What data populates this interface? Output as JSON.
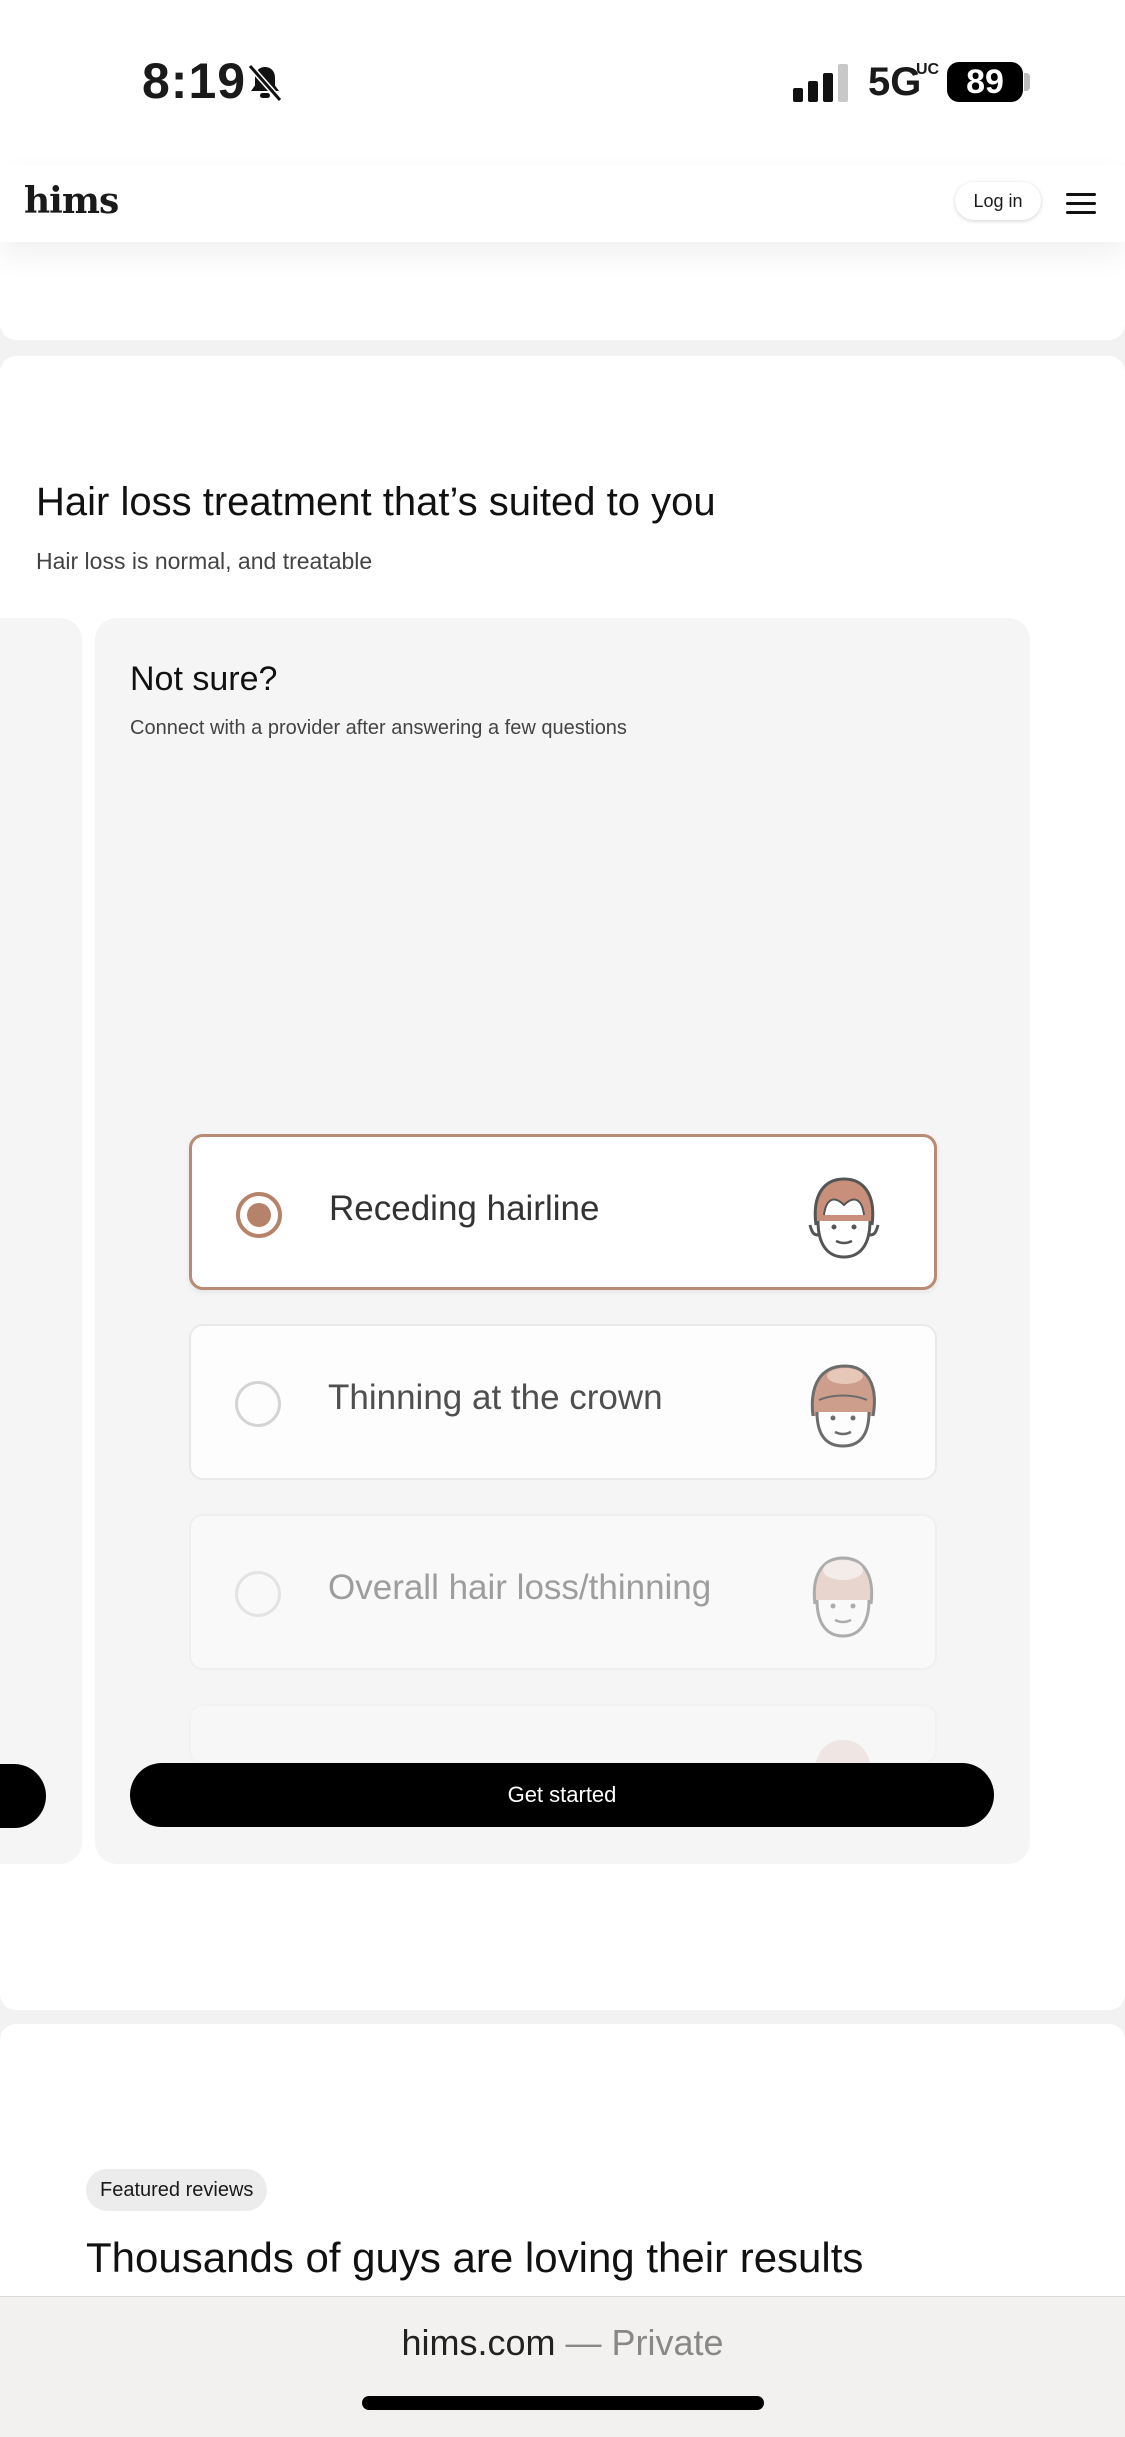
{
  "status_bar": {
    "time": "8:19",
    "network": "5G",
    "network_sup": "UC",
    "battery": "89"
  },
  "header": {
    "logo": "hims",
    "login_label": "Log in",
    "menu_icon": "hamburger-icon"
  },
  "hero": {
    "title": "Hair loss treatment that’s suited to you",
    "subtitle": "Hair loss is normal, and treatable"
  },
  "card": {
    "title": "Not sure?",
    "subtitle": "Connect with a provider after answering a few questions",
    "options": [
      {
        "label": "Receding hairline",
        "selected": true
      },
      {
        "label": "Thinning at the crown",
        "selected": false
      },
      {
        "label": "Overall hair loss/thinning",
        "selected": false
      }
    ],
    "cta": "Get started"
  },
  "reviews": {
    "badge": "Featured reviews",
    "title": "Thousands of guys are loving their results"
  },
  "browser": {
    "domain": "hims.com",
    "mode": " — Private"
  },
  "colors": {
    "accent": "#b6826a",
    "button": "#000000",
    "background": "#f2f2f2"
  }
}
